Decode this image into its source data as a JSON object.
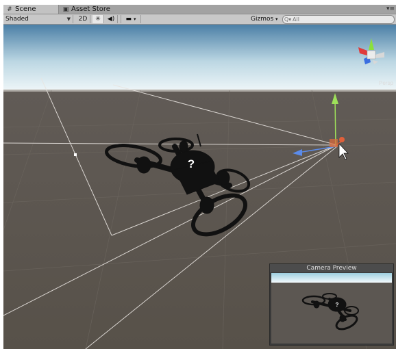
{
  "tabs": [
    {
      "label": "Scene",
      "icon": "scene-grid-icon"
    },
    {
      "label": "Asset Store",
      "icon": "asset-store-icon"
    }
  ],
  "toolbar": {
    "shading_mode": "Shaded",
    "mode_2d": "2D",
    "lighting_icon": "sun-icon",
    "audio_icon": "speaker-icon",
    "effects_icon": "image-icon",
    "gizmos_label": "Gizmos",
    "search_placeholder": "All",
    "search_prefix": "Q▾"
  },
  "gizmo": {
    "persp_label": "Persp"
  },
  "camera_preview": {
    "title": "Camera Preview"
  },
  "drone_question_mark": "?",
  "colors": {
    "sky_top": "#4a7fa8",
    "sky_bottom": "#e8f3f6",
    "ground": "#5a5450",
    "gizmo_x": "#e03a3a",
    "gizmo_y": "#8be03a",
    "gizmo_z": "#3a6ee0"
  }
}
